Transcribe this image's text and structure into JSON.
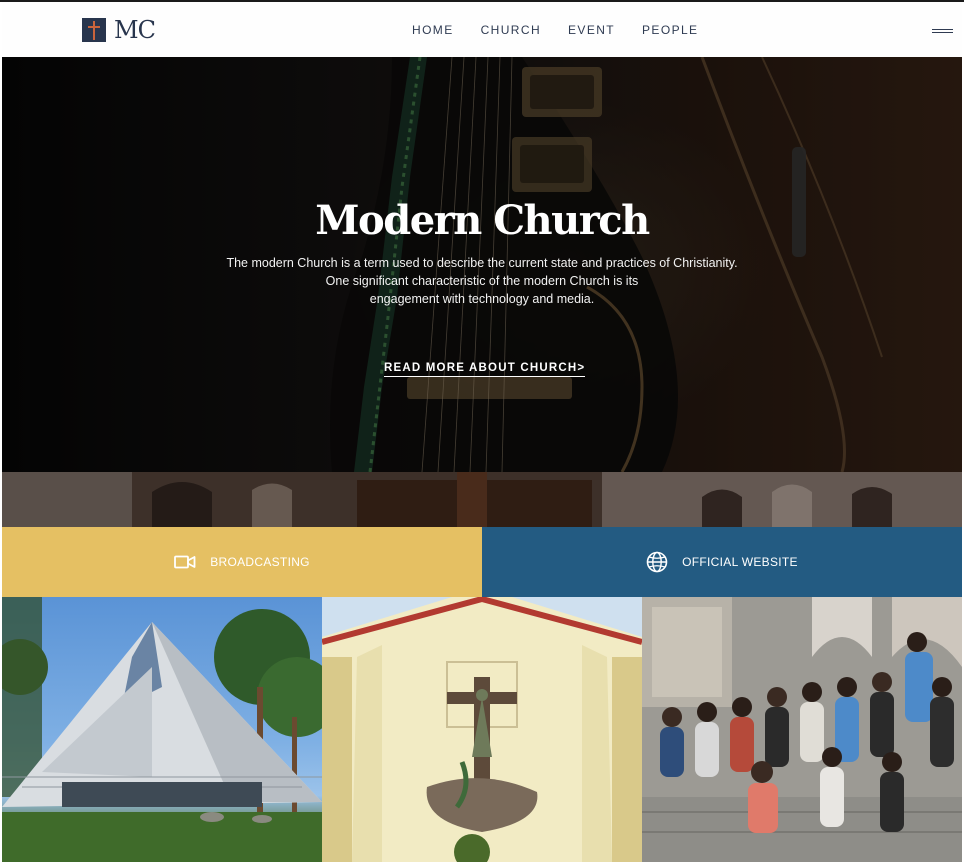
{
  "header": {
    "logo_text": "MC",
    "nav": [
      "HOME",
      "CHURCH",
      "EVENT",
      "PEOPLE"
    ]
  },
  "hero": {
    "title": "Modern Church",
    "description_lines": [
      "The modern Church is a term used to describe the current state and practices of Christianity.",
      "One significant characteristic of the modern Church is its",
      "engagement with technology and media."
    ],
    "link_label": "READ MORE ABOUT CHURCH",
    "link_chevron": ">"
  },
  "actions": {
    "broadcast_label": "BROADCASTING",
    "broadcast_icon": "video-camera-icon",
    "website_label": "OFFICIAL WEBSITE",
    "website_icon": "globe-icon"
  },
  "colors": {
    "navy": "#28354d",
    "accent_orange": "#c9643c",
    "gold": "#e5c063",
    "blue": "#235b82"
  }
}
